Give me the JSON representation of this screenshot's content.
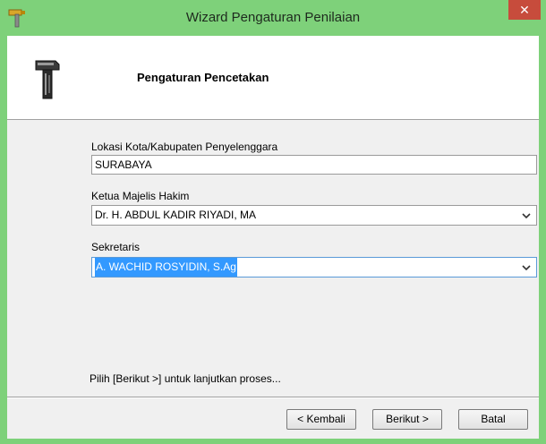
{
  "window": {
    "title": "Wizard Pengaturan Penilaian",
    "close_glyph": "✕",
    "accent_color": "#7ed17a",
    "close_color": "#c74c3c"
  },
  "header": {
    "title": "Pengaturan Pencetakan",
    "icon": "hammer-icon"
  },
  "form": {
    "lokasi": {
      "label": "Lokasi Kota/Kabupaten Penyelenggara",
      "value": "SURABAYA"
    },
    "ketua": {
      "label": "Ketua Majelis Hakim",
      "value": "Dr. H. ABDUL KADIR RIYADI, MA"
    },
    "sekretaris": {
      "label": "Sekretaris",
      "value": "A. WACHID ROSYIDIN, S.Ag"
    }
  },
  "hint": "Pilih [Berikut >] untuk lanjutkan proses...",
  "buttons": {
    "back": "< Kembali",
    "next": "Berikut >",
    "cancel": "Batal"
  }
}
